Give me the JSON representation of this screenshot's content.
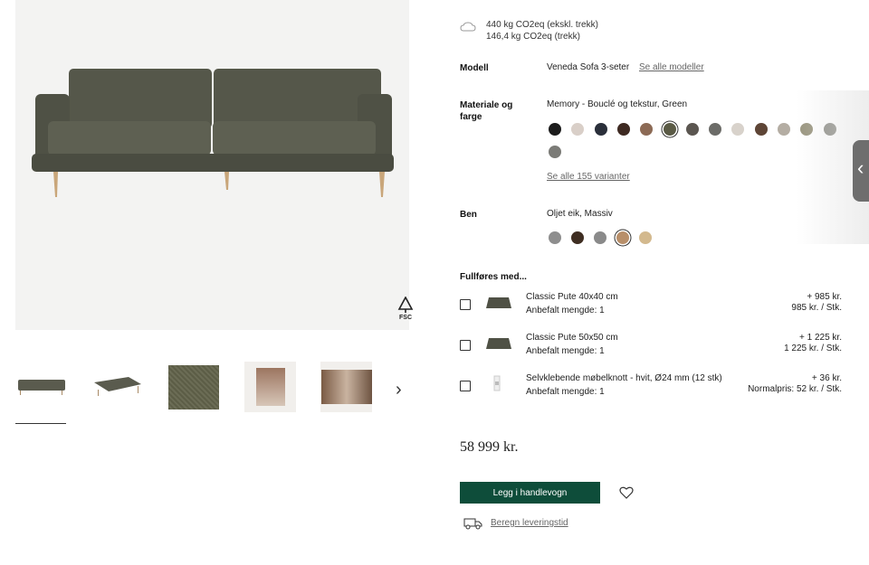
{
  "co2": {
    "line1": "440 kg CO2eq (ekskl. trekk)",
    "line2": "146,4 kg CO2eq (trekk)",
    "icon": "co2-cloud-icon"
  },
  "model": {
    "label": "Modell",
    "value": "Veneda Sofa 3-seter",
    "link": "Se alle modeller"
  },
  "material": {
    "label_line1": "Materiale og",
    "label_line2": "farge",
    "value": "Memory - Bouclé og tekstur, Green",
    "link": "Se alle 155 varianter",
    "swatches": [
      "#1c1c1c",
      "#d9cfc8",
      "#2a2f3a",
      "#3e2a22",
      "#8c6a55",
      "#5a5a45",
      "#5b5650",
      "#6c6c68",
      "#d8d2cb",
      "#5e4536",
      "#b4ada3",
      "#9a9680",
      "#8d8d86",
      "#7b7b77"
    ],
    "selected_index": 5
  },
  "legs": {
    "label": "Ben",
    "value": "Oljet eik, Massiv",
    "swatches": [
      "#8e8e8e",
      "#3f2e22",
      "#8a8a8a",
      "#b88f6a",
      "#d3b98e"
    ],
    "selected_index": 3
  },
  "complete": {
    "title": "Fullføres med...",
    "items": [
      {
        "name": "Classic Pute 40x40 cm",
        "qty": "Anbefalt mengde: 1",
        "price": "+ 985 kr.",
        "unit": "985 kr. / Stk."
      },
      {
        "name": "Classic Pute 50x50 cm",
        "qty": "Anbefalt mengde: 1",
        "price": "+ 1 225 kr.",
        "unit": "1 225 kr. / Stk."
      },
      {
        "name": "Selvklebende møbelknott - hvit, Ø24 mm (12 stk)",
        "qty": "Anbefalt mengde: 1",
        "price": "+ 36 kr.",
        "unit": "Normalpris: 52 kr. / Stk."
      }
    ]
  },
  "price": "58 999 kr.",
  "cart_button": "Legg i handlevogn",
  "delivery_link": "Beregn leveringstid",
  "fsc": "FSC",
  "colors": {
    "accent": "#0e4d3a",
    "sofa": "#5c5d4f"
  }
}
